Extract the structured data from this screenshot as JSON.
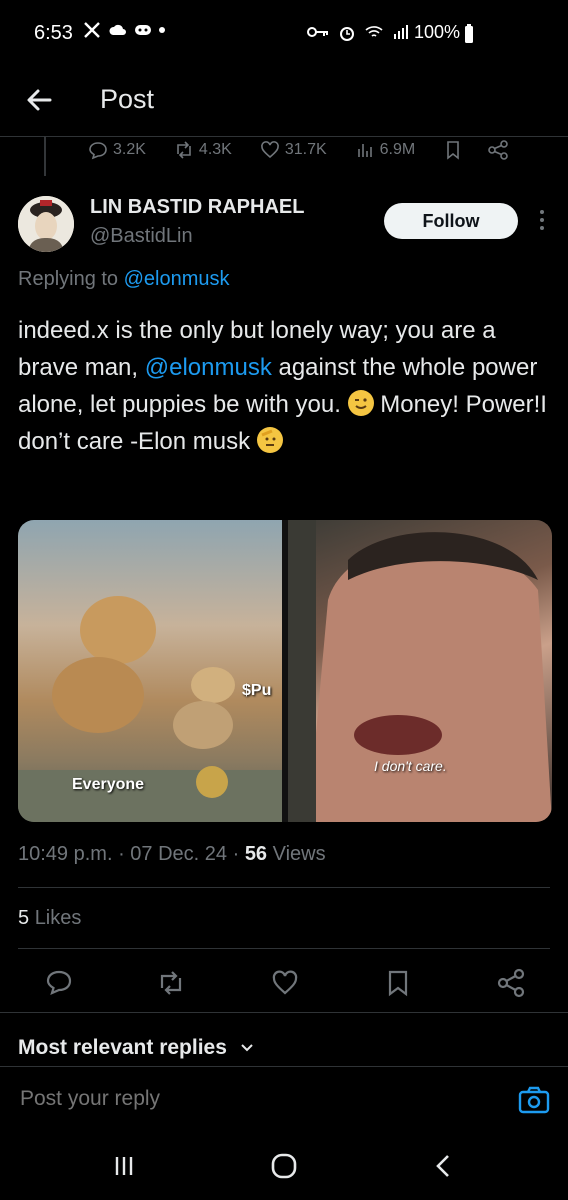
{
  "status_bar": {
    "time": "6:53",
    "battery": "100%"
  },
  "header": {
    "title": "Post"
  },
  "parent_stats": {
    "replies": "3.2K",
    "reposts": "4.3K",
    "likes": "31.7K",
    "views": "6.9M"
  },
  "post": {
    "author_name": "LIN BASTID RAPHAEL",
    "author_handle": "@BastidLin",
    "follow_label": "Follow",
    "replying_prefix": "Replying to ",
    "replying_handle": "@elonmusk",
    "text_1": "indeed.x is the only but lonely way; you are a brave man, ",
    "mention": "@elonmusk",
    "text_2": " against the whole power alone, let puppies be with you. ",
    "text_3": " Money! Power!I don’t care -Elon musk ",
    "media_left_labels": {
      "everyone": "Everyone",
      "pu": "$Pu"
    },
    "media_right_caption": "I don't care.",
    "time": "10:49 p.m.",
    "date": "07 Dec. 24",
    "views_count": "56",
    "views_label": "Views",
    "likes_count": "5",
    "likes_label": "Likes"
  },
  "replies_section": {
    "sort_label": "Most relevant replies"
  },
  "reply_box": {
    "placeholder": "Post your reply"
  },
  "colors": {
    "accent": "#1d9bf0",
    "muted": "#71767b",
    "text": "#e7e9ea",
    "divider": "#2f3336"
  }
}
